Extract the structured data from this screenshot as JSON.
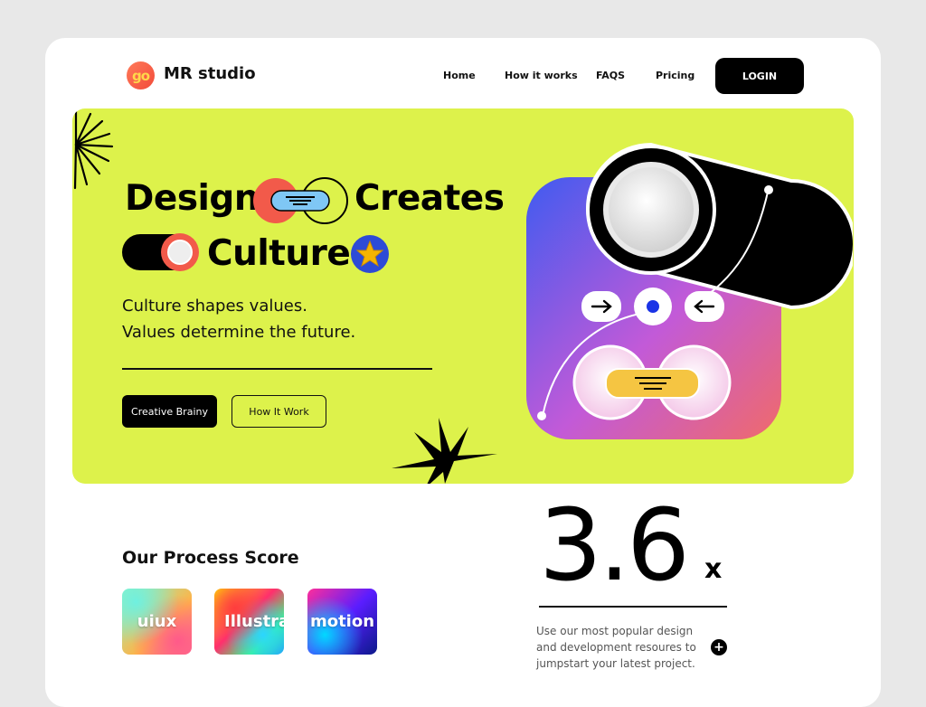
{
  "header": {
    "logo_glyph": "go",
    "brand": "MR studio",
    "nav": [
      "Home",
      "How it works",
      "FAQS",
      "Pricing"
    ],
    "login_label": "LOGIN"
  },
  "hero": {
    "headline_word_1": "Design",
    "headline_word_2": "Creates",
    "headline_word_3": "Culture",
    "subtitle_line_1": "Culture shapes values.",
    "subtitle_line_2": "Values determine the future.",
    "primary_button": "Creative Brainy",
    "secondary_button": "How It Work",
    "background_color": "#ddf24b"
  },
  "process": {
    "title": "Our Process Score",
    "tiles": [
      "uiux",
      "Illustra",
      "motion"
    ]
  },
  "score": {
    "value": "3.6",
    "suffix": "x",
    "description": "Use our most popular design and development resoures to jumpstart your latest project."
  },
  "icons": [
    "burst-icon",
    "star-icon",
    "toggle-icon",
    "arrow-right-icon",
    "arrow-left-icon",
    "plus-icon"
  ]
}
